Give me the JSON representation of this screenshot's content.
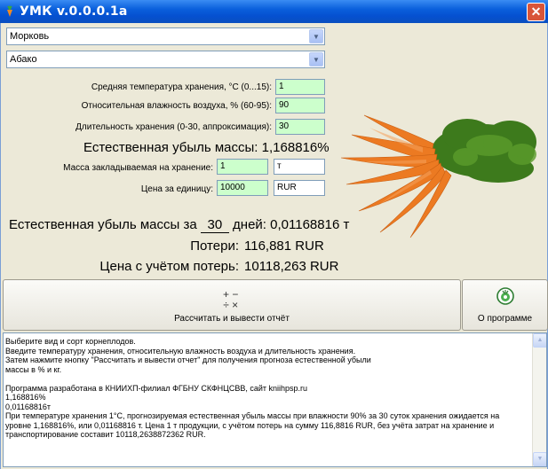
{
  "window": {
    "title": "УМК v.0.0.0.1a"
  },
  "selectors": {
    "crop": "Морковь",
    "variety": "Абако"
  },
  "inputs": {
    "temperature": {
      "label": "Средняя температура хранения, °С (0...15):",
      "value": "1"
    },
    "humidity": {
      "label": "Относительная влажность воздуха, % (60-95):",
      "value": "90"
    },
    "duration": {
      "label": "Длительность хранения (0-30, аппроксимация):",
      "value": "30"
    },
    "mass": {
      "label": "Масса закладываемая на хранение:",
      "value": "1",
      "unit": "т"
    },
    "price": {
      "label": "Цена за единицу:",
      "value": "10000",
      "currency": "RUR"
    }
  },
  "results": {
    "natural_loss_pct_label": "Естественная убыль массы:",
    "natural_loss_pct_value": "1,168816%",
    "loss_for_days_prefix": "Естественная убыль массы за",
    "loss_days": "30",
    "loss_days_suffix": "дней:",
    "loss_for_days_value": "0,01168816 т",
    "losses_label": "Потери:",
    "losses_value": "116,881 RUR",
    "price_with_losses_label": "Цена с учётом потерь:",
    "price_with_losses_value": "10118,263 RUR"
  },
  "buttons": {
    "calculate": "Рассчитать и вывести отчёт",
    "about": "О программе"
  },
  "icons": {
    "app": "carrot-app-icon",
    "calculate": "calculator-icon",
    "about": "program-logo-icon"
  },
  "output_lines": [
    "Выберите вид и сорт корнеплодов.",
    "Введите температуру хранения, относительную влажность воздуха и длительность хранения.",
    "Затем нажмите кнопку \"Рассчитать и вывести отчет\" для получения прогноза естественной убыли",
    "массы в % и кг.",
    "",
    "Программа разработана в КНИИХП-филиал ФГБНУ СКФНЦСВВ, сайт kniihpsp.ru",
    "1,168816%",
    "0,01168816т",
    "При температуре хранения 1°С, прогнозируемая естественная убыль массы при влажности 90% за 30 суток хранения ожидается на",
    "уровне 1,168816%, или 0,01168816 т. Цена 1 т продукции, с учётом потерь на сумму 116,8816 RUR, без учёта затрат на хранение и",
    "транспортирование составит 10118,2638872362 RUR."
  ],
  "colors": {
    "titlebar": "#0a5fdc",
    "input_green": "#ccffcc",
    "window_bg": "#ece9d8",
    "close": "#d8553a"
  }
}
